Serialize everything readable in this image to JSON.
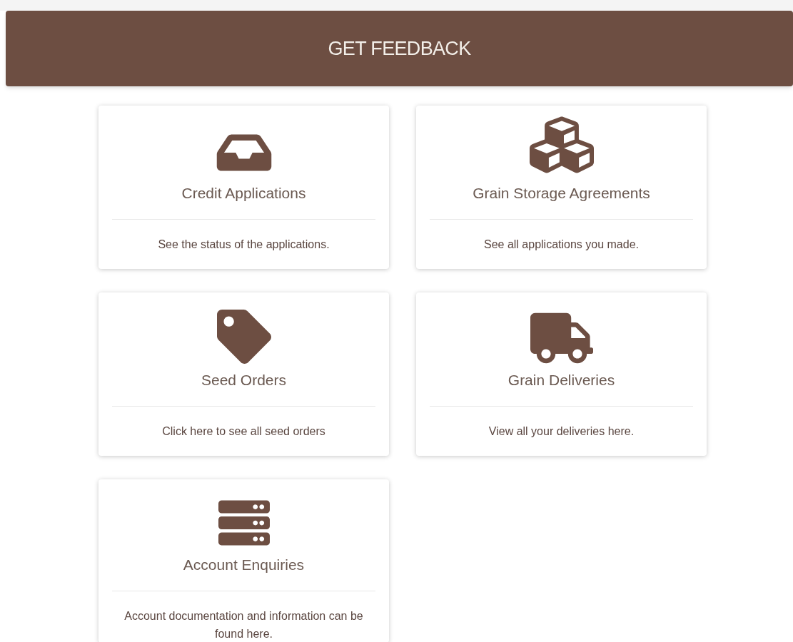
{
  "header": {
    "title": "GET FEEDBACK"
  },
  "cards": [
    {
      "title": "Credit Applications",
      "description": "See the status of the applications."
    },
    {
      "title": "Grain Storage Agreements",
      "description": "See all applications you made."
    },
    {
      "title": "Seed Orders",
      "description": "Click here to see all seed orders"
    },
    {
      "title": "Grain Deliveries",
      "description": "View all your deliveries here."
    },
    {
      "title": "Account Enquiries",
      "description": "Account documentation and information can be found here."
    }
  ]
}
